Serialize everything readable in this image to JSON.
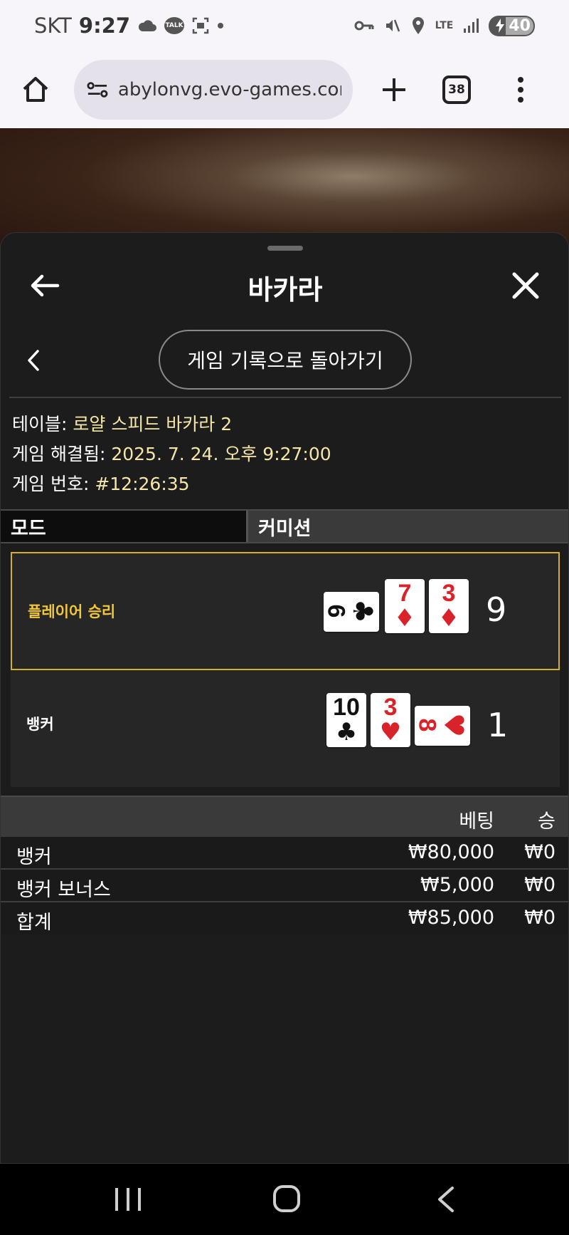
{
  "status_bar": {
    "carrier": "SKT",
    "time": "9:27",
    "talk_badge": "TALK",
    "network": "LTE",
    "battery": "40",
    "icons": [
      "cloud-icon",
      "kakaotalk-icon",
      "screenshot-icon",
      "dot-icon",
      "vpn-key-icon",
      "mute-icon",
      "location-icon",
      "lte-icon",
      "signal-icon",
      "battery-charging-icon"
    ]
  },
  "browser": {
    "url": "abylonvg.evo-games.com",
    "tab_count": "38"
  },
  "sheet": {
    "title": "바카라",
    "back_to_history": "게임 기록으로 돌아가기"
  },
  "info": {
    "table_label": "테이블:",
    "table_value": "로얄 스피드 바카라 2",
    "resolved_label": "게임 해결됨:",
    "resolved_value": "2025. 7. 24. 오후 9:27:00",
    "number_label": "게임 번호:",
    "number_value": "#12:26:35"
  },
  "mode_row": {
    "mode": "모드",
    "commission": "커미션"
  },
  "results": {
    "player": {
      "label": "플레이어 승리",
      "score": "9",
      "cards": [
        {
          "rank": "6",
          "suit": "♣",
          "color": "#111111",
          "sideways": true
        },
        {
          "rank": "7",
          "suit": "♦",
          "color": "#d8232a",
          "sideways": false
        },
        {
          "rank": "3",
          "suit": "♦",
          "color": "#d8232a",
          "sideways": false
        }
      ]
    },
    "banker": {
      "label": "뱅커",
      "score": "1",
      "cards": [
        {
          "rank": "10",
          "suit": "♣",
          "color": "#111111",
          "sideways": false
        },
        {
          "rank": "3",
          "suit": "♥",
          "color": "#d8232a",
          "sideways": false
        },
        {
          "rank": "8",
          "suit": "♥",
          "color": "#d8232a",
          "sideways": true
        }
      ]
    },
    "winner_border_color": "#d4b02a"
  },
  "bets": {
    "col_bet": "베팅",
    "col_win": "승",
    "rows": [
      {
        "name": "뱅커",
        "amount": "₩80,000",
        "win": "₩0"
      },
      {
        "name": "뱅커 보너스",
        "amount": "₩5,000",
        "win": "₩0"
      }
    ],
    "total": {
      "name": "합계",
      "amount": "₩85,000",
      "win": "₩0"
    }
  }
}
